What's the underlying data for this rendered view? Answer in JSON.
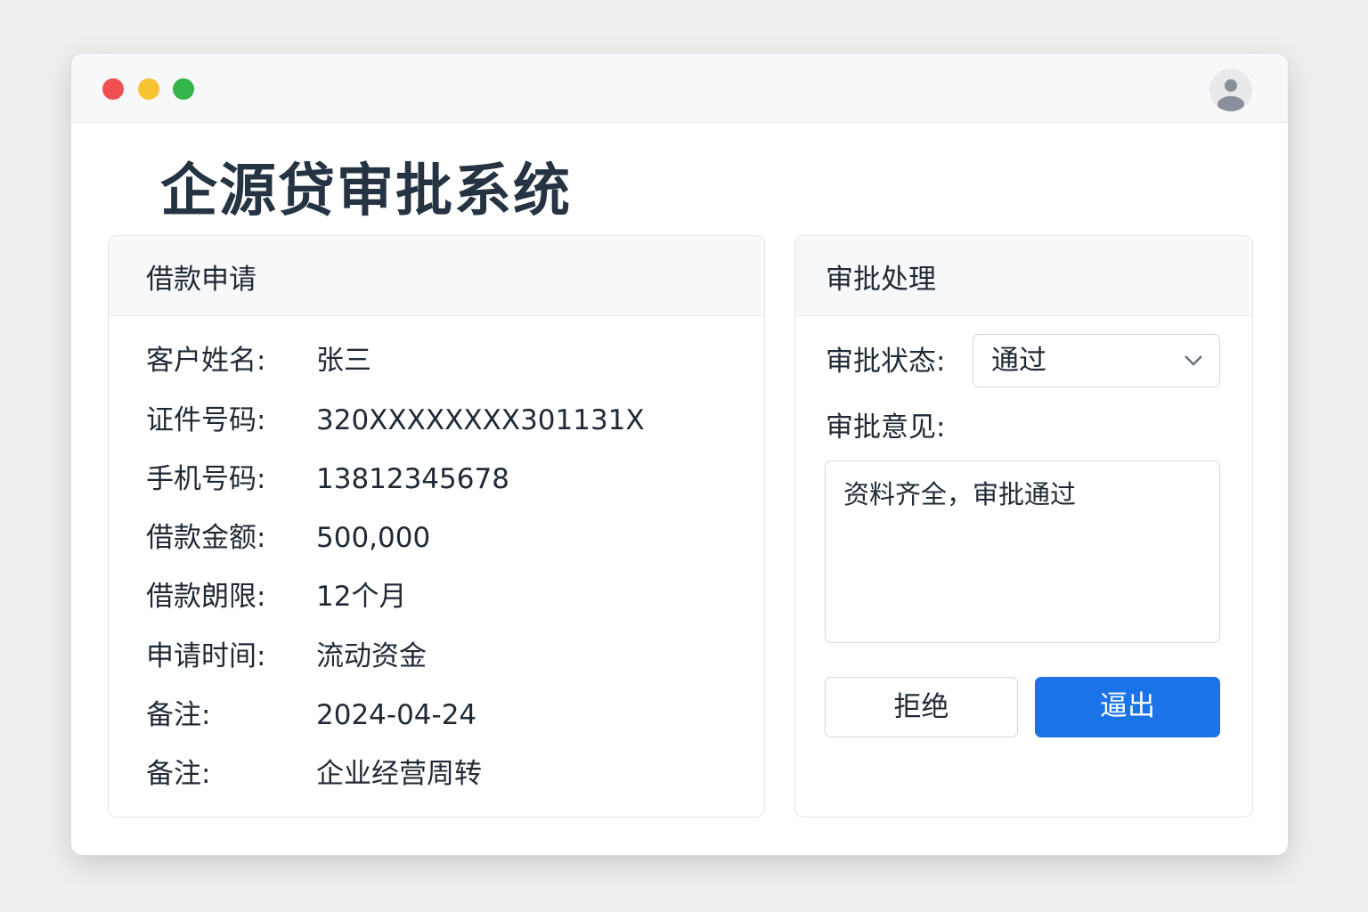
{
  "window": {
    "traffic_colors": [
      "#f05050",
      "#f7c330",
      "#33b54a"
    ],
    "avatar_icon": "user-avatar-icon"
  },
  "app_title": "企源贷审批系统",
  "loan": {
    "header": "借款申请",
    "rows": [
      {
        "label": "客户姓名:",
        "value": "张三"
      },
      {
        "label": "证件号码:",
        "value": "320XXXXXXXX301131X"
      },
      {
        "label": "手机号码:",
        "value": "13812345678"
      },
      {
        "label": "借款金额:",
        "value": "500,000"
      },
      {
        "label": "借款朗限:",
        "value": "12个月"
      },
      {
        "label": "申请时间:",
        "value": "流动资金"
      },
      {
        "label": "备注:",
        "value": "2024-04-24"
      },
      {
        "label": "备注:",
        "value": "企业经营周转"
      }
    ]
  },
  "approval": {
    "header": "审批处理",
    "status_label": "审批状态:",
    "status_value": "通过",
    "opinion_label": "审批意见:",
    "opinion_value": "资料齐全，审批通过",
    "reject_label": "拒绝",
    "submit_label": "逼出",
    "accent": "#1a73e8"
  }
}
